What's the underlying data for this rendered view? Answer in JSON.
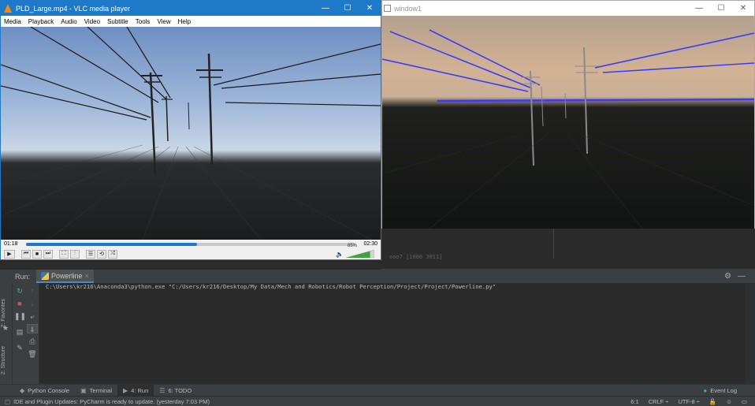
{
  "vlc": {
    "title": "PLD_Large.mp4 - VLC media player",
    "menu": [
      "Media",
      "Playback",
      "Audio",
      "Video",
      "Subtitle",
      "Tools",
      "View",
      "Help"
    ],
    "elapsed": "01:18",
    "total": "02:30",
    "progress": 0.52,
    "volume": "85%",
    "volume_level": 0.85
  },
  "window1": {
    "title": "window1"
  },
  "ide": {
    "editor_faint": "ooo7 [1000 3011]",
    "run_label": "Run:",
    "run_tab": "Powerline",
    "console_line": "C:\\Users\\kr216\\Anaconda3\\python.exe \"C:/Users/kr216/Desktop/My Data/Mech and Robotics/Robot Perception/Project/Project/Powerline.py\"",
    "left_tabs": [
      "2: Favorites",
      "2: Structure"
    ],
    "bottom_tabs": [
      {
        "label": "Python Console",
        "icon": "python-console-icon"
      },
      {
        "label": "Terminal",
        "icon": "terminal-icon"
      },
      {
        "label": "4: Run",
        "icon": "run-icon"
      },
      {
        "label": "6: TODO",
        "icon": "todo-icon"
      }
    ],
    "event_log": "Event Log",
    "status_message": "IDE and Plugin Updates: PyCharm is ready to update. (yesterday 7:03 PM)",
    "status_right": [
      "6:1",
      "CRLF ÷",
      "UTF-8 ÷"
    ]
  },
  "colors": {
    "vlc_accent": "#1e7ac8",
    "ide_bg": "#2b2b2b",
    "detected_lines": "#3a3aff"
  }
}
